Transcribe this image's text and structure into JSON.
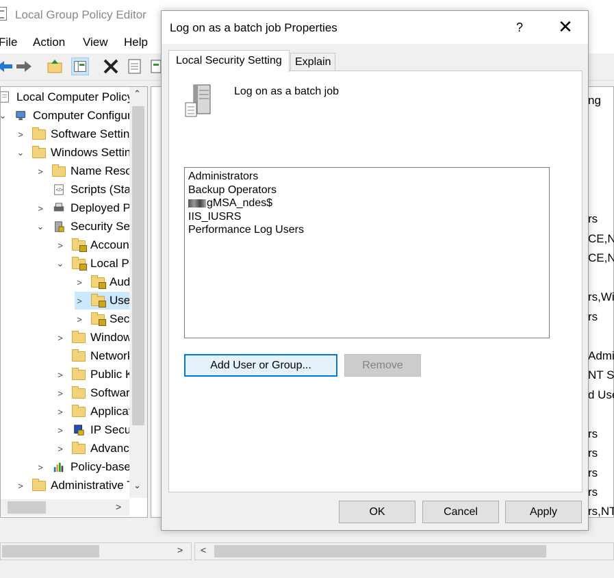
{
  "background": {
    "title": "Local Group Policy Editor",
    "menu": [
      "File",
      "Action",
      "View",
      "Help"
    ],
    "tree": [
      {
        "label": "Local Computer Policy",
        "level": 0,
        "expander": "",
        "icon": "policy-icon"
      },
      {
        "label": "Computer Configuration",
        "level": 0,
        "expander": "expanded",
        "icon": "computer-icon"
      },
      {
        "label": "Software Settings",
        "level": 1,
        "expander": "collapsed",
        "icon": "folder-icon"
      },
      {
        "label": "Windows Settings",
        "level": 1,
        "expander": "expanded",
        "icon": "folder-icon"
      },
      {
        "label": "Name Resolution Policy",
        "level": 2,
        "expander": "collapsed",
        "icon": "folder-icon"
      },
      {
        "label": "Scripts (Startup/Shutdown)",
        "level": 2,
        "expander": "",
        "icon": "scripts-icon"
      },
      {
        "label": "Deployed Printers",
        "level": 2,
        "expander": "collapsed",
        "icon": "printer-icon"
      },
      {
        "label": "Security Settings",
        "level": 2,
        "expander": "expanded",
        "icon": "security-icon"
      },
      {
        "label": "Account Policies",
        "level": 3,
        "expander": "collapsed",
        "icon": "locked-folder-icon"
      },
      {
        "label": "Local Policies",
        "level": 3,
        "expander": "expanded",
        "icon": "locked-folder-icon"
      },
      {
        "label": "Audit Policy",
        "level": 4,
        "expander": "collapsed",
        "icon": "locked-folder-icon"
      },
      {
        "label": "User Rights Assignment",
        "level": 4,
        "expander": "collapsed",
        "icon": "locked-folder-icon"
      },
      {
        "label": "Security Options",
        "level": 4,
        "expander": "collapsed",
        "icon": "locked-folder-icon"
      },
      {
        "label": "Windows Defender Firewall",
        "level": 3,
        "expander": "collapsed",
        "icon": "folder-icon"
      },
      {
        "label": "Network List Manager Policies",
        "level": 3,
        "expander": "",
        "icon": "folder-icon"
      },
      {
        "label": "Public Key Policies",
        "level": 3,
        "expander": "collapsed",
        "icon": "folder-icon"
      },
      {
        "label": "Software Restriction Policies",
        "level": 3,
        "expander": "collapsed",
        "icon": "folder-icon"
      },
      {
        "label": "Application Control Policies",
        "level": 3,
        "expander": "collapsed",
        "icon": "folder-icon"
      },
      {
        "label": "IP Security Policies",
        "level": 3,
        "expander": "collapsed",
        "icon": "ipsec-icon"
      },
      {
        "label": "Advanced Audit Policy",
        "level": 3,
        "expander": "collapsed",
        "icon": "folder-icon"
      },
      {
        "label": "Policy-based QoS",
        "level": 2,
        "expander": "collapsed",
        "icon": "qos-icon"
      },
      {
        "label": "Administrative Templates",
        "level": 1,
        "expander": "collapsed",
        "icon": "folder-icon"
      }
    ],
    "right_fragments": [
      "ng",
      "rs",
      "CE,NE",
      "CE,NE",
      "rs,Wi",
      "rs",
      "Admi",
      "NT SE",
      "d Use",
      "rs",
      "rs",
      "rs",
      "rs",
      "rs,NT"
    ]
  },
  "dialog": {
    "title": "Log on as a batch job Properties",
    "help_label": "?",
    "close_label": "✕",
    "tabs": {
      "active": "Local Security Setting",
      "inactive": "Explain"
    },
    "policy_name": "Log on as a batch job",
    "members": [
      "Administrators",
      "Backup Operators",
      "gMSA_ndes$",
      "IIS_IUSRS",
      "Performance Log Users"
    ],
    "add_button": "Add User or Group...",
    "remove_button": "Remove",
    "ok_button": "OK",
    "cancel_button": "Cancel",
    "apply_button": "Apply"
  },
  "colors": {
    "accent": "#0078d7",
    "folder": "#f3d37a",
    "disabled_text": "#838383"
  }
}
